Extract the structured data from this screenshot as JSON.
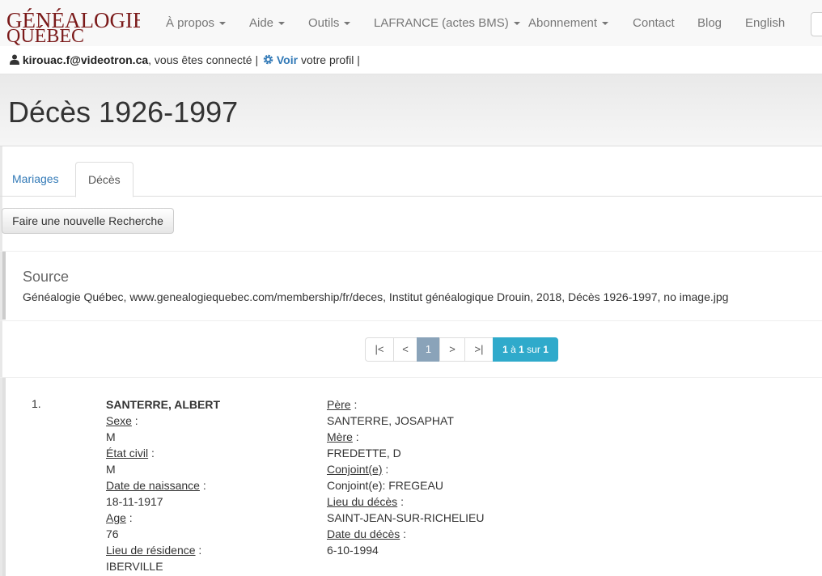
{
  "nav": {
    "logo_line1": "GÉNÉALOGIE",
    "logo_line2": "QUÉBEC",
    "items": [
      {
        "label": "À propos",
        "dropdown": true
      },
      {
        "label": "Aide",
        "dropdown": true
      },
      {
        "label": "Outils",
        "dropdown": true
      },
      {
        "label": "LAFRANCE (actes BMS)",
        "dropdown": true
      },
      {
        "label": "Abonnement",
        "dropdown": true
      },
      {
        "label": "Contact",
        "dropdown": false
      },
      {
        "label": "Blog",
        "dropdown": false
      },
      {
        "label": "English",
        "dropdown": false
      }
    ]
  },
  "user": {
    "email": "kirouac.f@videotron.ca",
    "connected_text": ", vous êtes connecté |",
    "view_link": "Voir",
    "profile_text": "votre profil |"
  },
  "page": {
    "title": "Décès 1926-1997"
  },
  "tabs": [
    {
      "label": "Mariages",
      "active": false
    },
    {
      "label": "Décès",
      "active": true
    }
  ],
  "buttons": {
    "new_search": "Faire une nouvelle Recherche"
  },
  "source": {
    "title": "Source",
    "text": "Généalogie Québec, www.genealogiequebec.com/membership/fr/deces, Institut généalogique Drouin, 2018, Décès 1926-1997, no image.jpg"
  },
  "pagination": {
    "first": "|<",
    "prev": "<",
    "current": "1",
    "next": ">",
    "last": ">|",
    "count_from": "1",
    "count_sep": " à ",
    "count_to": "1",
    "count_mid": " sur ",
    "count_total": "1"
  },
  "record": {
    "number": "1.",
    "name": "SANTERRE, ALBERT",
    "sexe_label": "Sexe",
    "sexe": "M",
    "etat_label": "État civil",
    "etat": "M",
    "naissance_label": "Date de naissance",
    "naissance": "18-11-1917",
    "age_label": "Age",
    "age": "76",
    "residence_label": "Lieu de résidence",
    "residence": "IBERVILLE",
    "pere_label": "Père",
    "pere": "SANTERRE, JOSAPHAT",
    "mere_label": "Mère",
    "mere": "FREDETTE, D",
    "conjoint_label": "Conjoint(e)",
    "conjoint": "Conjoint(e): FREGEAU",
    "lieu_deces_label": "Lieu du décès",
    "lieu_deces": "SAINT-JEAN-SUR-RICHELIEU",
    "date_deces_label": "Date du décès",
    "date_deces": "6-10-1994",
    "colon": " :"
  },
  "colors": {
    "link": "#337ab7",
    "logo": "#7b1a1a",
    "count_badge": "#2faacb",
    "current_page": "#8aa3b9"
  },
  "icons": {
    "user": "user-icon",
    "gear": "gear-icon",
    "caret": "caret-down-icon"
  }
}
